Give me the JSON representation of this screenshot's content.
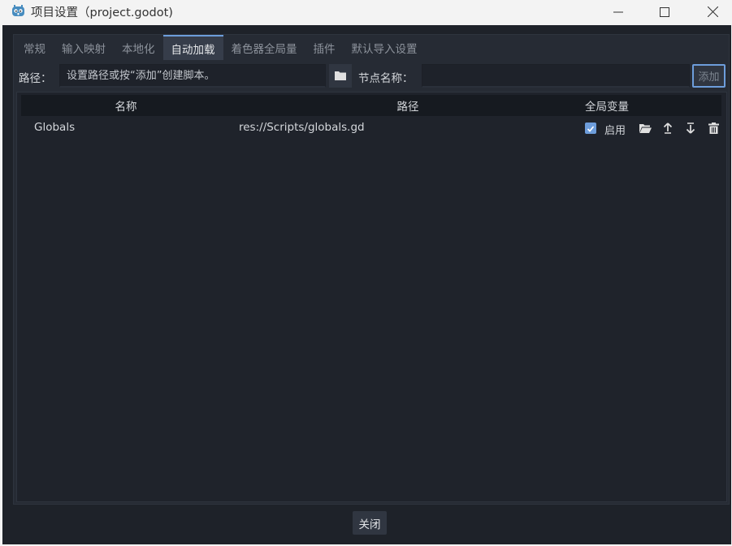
{
  "window": {
    "title": "项目设置（project.godot)",
    "icons": {
      "app": "godot-icon",
      "minimize": "minimize-icon",
      "maximize": "maximize-icon",
      "close": "close-icon"
    }
  },
  "tabs": [
    {
      "label": "常规",
      "active": false
    },
    {
      "label": "输入映射",
      "active": false
    },
    {
      "label": "本地化",
      "active": false
    },
    {
      "label": "自动加载",
      "active": true
    },
    {
      "label": "着色器全局量",
      "active": false
    },
    {
      "label": "插件",
      "active": false
    },
    {
      "label": "默认导入设置",
      "active": false
    }
  ],
  "toolbar": {
    "path_label": "路径：",
    "path_placeholder": "设置路径或按“添加”创建脚本。",
    "node_name_label": "节点名称：",
    "node_name_value": "",
    "add_label": "添加"
  },
  "table": {
    "headers": {
      "name": "名称",
      "path": "路径",
      "global": "全局变量"
    },
    "rows": [
      {
        "name": "Globals",
        "path": "res://Scripts/globals.gd",
        "enabled": true,
        "enable_label": "启用"
      }
    ]
  },
  "footer": {
    "close_label": "关闭"
  },
  "colors": {
    "accent": "#6d9ddb",
    "background": "#1e2229",
    "panel": "#262b34",
    "header": "#161a20"
  }
}
